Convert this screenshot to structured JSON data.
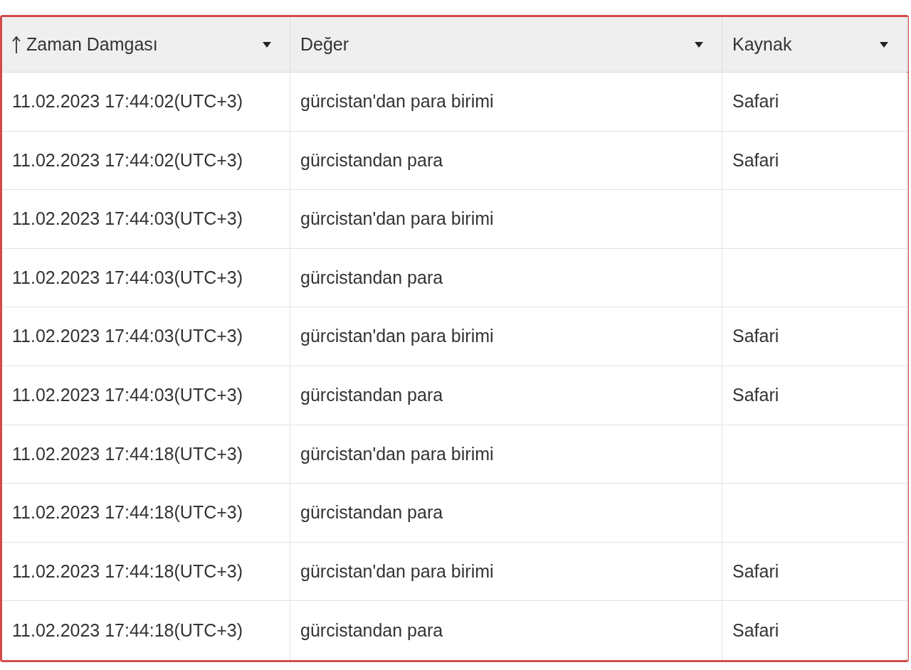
{
  "table": {
    "columns": [
      {
        "label": "Zaman Damgası",
        "sorted": true,
        "filter": true
      },
      {
        "label": "Değer",
        "sorted": false,
        "filter": true
      },
      {
        "label": "Kaynak",
        "sorted": false,
        "filter": true
      }
    ],
    "rows": [
      [
        "11.02.2023 17:44:02(UTC+3)",
        "gürcistan'dan para birimi",
        "Safari"
      ],
      [
        "11.02.2023 17:44:02(UTC+3)",
        "gürcistandan para",
        "Safari"
      ],
      [
        "11.02.2023 17:44:03(UTC+3)",
        "gürcistan'dan para birimi",
        ""
      ],
      [
        "11.02.2023 17:44:03(UTC+3)",
        "gürcistandan para",
        ""
      ],
      [
        "11.02.2023 17:44:03(UTC+3)",
        "gürcistan'dan para birimi",
        "Safari"
      ],
      [
        "11.02.2023 17:44:03(UTC+3)",
        "gürcistandan para",
        "Safari"
      ],
      [
        "11.02.2023 17:44:18(UTC+3)",
        "gürcistan'dan para birimi",
        ""
      ],
      [
        "11.02.2023 17:44:18(UTC+3)",
        "gürcistandan para",
        ""
      ],
      [
        "11.02.2023 17:44:18(UTC+3)",
        "gürcistan'dan para birimi",
        "Safari"
      ],
      [
        "11.02.2023 17:44:18(UTC+3)",
        "gürcistandan para",
        "Safari"
      ]
    ]
  }
}
